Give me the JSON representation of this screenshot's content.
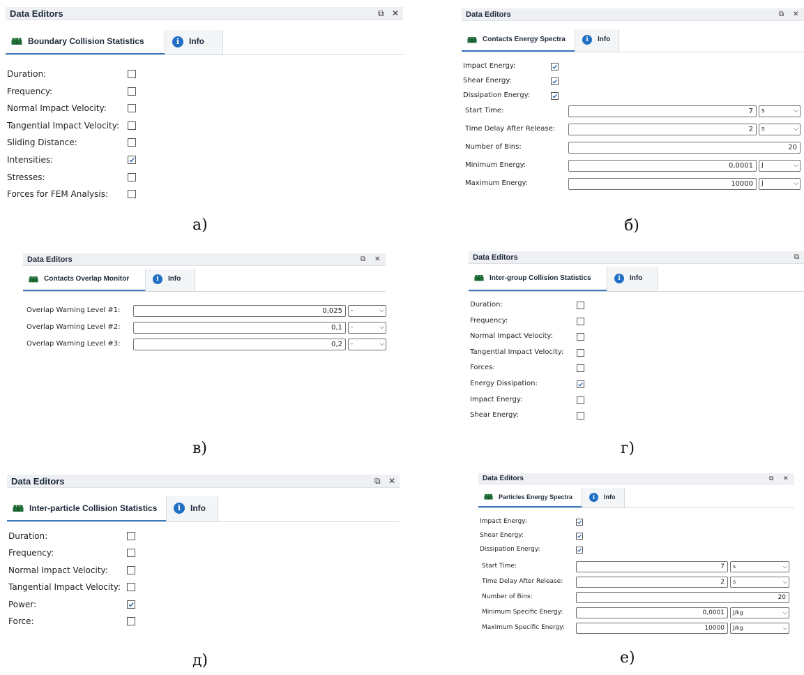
{
  "common": {
    "window_title": "Data Editors",
    "info_tab": "Info",
    "restore_glyph": "⧉",
    "close_glyph": "✕",
    "dropdown_glyph": "⌵",
    "tab_icon": "bricks-icon",
    "info_icon": "info-icon"
  },
  "panel_a": {
    "caption": "а)",
    "tab": "Boundary Collision Statistics",
    "rows": [
      {
        "label": "Duration:",
        "checked": false
      },
      {
        "label": "Frequency:",
        "checked": false
      },
      {
        "label": "Normal Impact Velocity:",
        "checked": false
      },
      {
        "label": "Tangential Impact Velocity:",
        "checked": false
      },
      {
        "label": "Sliding Distance:",
        "checked": false
      },
      {
        "label": "Intensities:",
        "checked": true
      },
      {
        "label": "Stresses:",
        "checked": false
      },
      {
        "label": "Forces for FEM Analysis:",
        "checked": false
      }
    ]
  },
  "panel_b": {
    "caption": "б)",
    "tab": "Contacts Energy Spectra",
    "checks": [
      {
        "label": "Impact Energy:",
        "checked": true
      },
      {
        "label": "Shear Energy:",
        "checked": true
      },
      {
        "label": "Dissipation Energy:",
        "checked": true
      }
    ],
    "fields": [
      {
        "label": "Start Time:",
        "value": "7",
        "unit": "s"
      },
      {
        "label": "Time Delay After Release:",
        "value": "2",
        "unit": "s"
      },
      {
        "label": "Number of Bins:",
        "value": "20",
        "unit": ""
      },
      {
        "label": "Minimum Energy:",
        "value": "0,0001",
        "unit": "J"
      },
      {
        "label": "Maximum Energy:",
        "value": "10000",
        "unit": "J"
      }
    ]
  },
  "panel_v": {
    "caption": "в)",
    "tab": "Contacts Overlap Monitor",
    "fields": [
      {
        "label": "Overlap Warning Level #1:",
        "value": "0,025",
        "unit": "-"
      },
      {
        "label": "Overlap Warning Level #2:",
        "value": "0,1",
        "unit": "-"
      },
      {
        "label": "Overlap Warning Level #3:",
        "value": "0,2",
        "unit": "-"
      }
    ]
  },
  "panel_g": {
    "caption": "г)",
    "tab": "Inter-group Collision Statistics",
    "rows": [
      {
        "label": "Duration:",
        "checked": false
      },
      {
        "label": "Frequency:",
        "checked": false
      },
      {
        "label": "Normal Impact Velocity:",
        "checked": false
      },
      {
        "label": "Tangential Impact Velocity:",
        "checked": false
      },
      {
        "label": "Forces:",
        "checked": false
      },
      {
        "label": "Energy Dissipation:",
        "checked": true
      },
      {
        "label": "Impact Energy:",
        "checked": false
      },
      {
        "label": "Shear Energy:",
        "checked": false
      }
    ]
  },
  "panel_d": {
    "caption": "д)",
    "tab": "Inter-particle Collision Statistics",
    "rows": [
      {
        "label": "Duration:",
        "checked": false
      },
      {
        "label": "Frequency:",
        "checked": false
      },
      {
        "label": "Normal Impact Velocity:",
        "checked": false
      },
      {
        "label": "Tangential Impact Velocity:",
        "checked": false
      },
      {
        "label": "Power:",
        "checked": true
      },
      {
        "label": "Force:",
        "checked": false
      }
    ]
  },
  "panel_e": {
    "caption": "е)",
    "tab": "Particles Energy Spectra",
    "checks": [
      {
        "label": "Impact Energy:",
        "checked": true
      },
      {
        "label": "Shear Energy:",
        "checked": true
      },
      {
        "label": "Dissipation Energy:",
        "checked": true
      }
    ],
    "fields": [
      {
        "label": "Start Time:",
        "value": "7",
        "unit": "s"
      },
      {
        "label": "Time Delay After Release:",
        "value": "2",
        "unit": "s"
      },
      {
        "label": "Number of Bins:",
        "value": "20",
        "unit": ""
      },
      {
        "label": "Minimum Specific Energy:",
        "value": "0,0001",
        "unit": "J/kg"
      },
      {
        "label": "Maximum Specific Energy:",
        "value": "10000",
        "unit": "J/kg"
      }
    ]
  }
}
